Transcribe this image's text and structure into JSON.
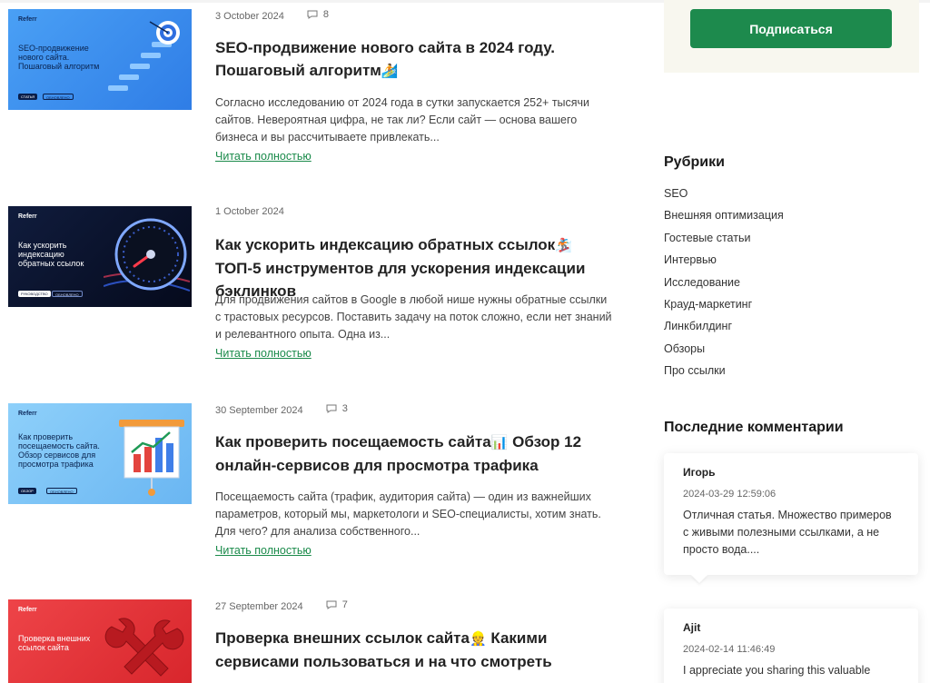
{
  "posts": [
    {
      "date": "3 October 2024",
      "comments": "8",
      "title": "SEO-продвижение нового сайта в 2024 году. Пошаговый алгоритм",
      "title_emoji": "🏄",
      "excerpt": "Согласно исследованию от 2024 года в сутки запускается 252+ тысячи сайтов. Невероятная цифра, не так ли? Если сайт — основа вашего бизнеса и вы рассчитываете привлекать...",
      "read_more": "Читать полностью",
      "thumb": {
        "brand": "Referr",
        "headline": "SEO-продвижение нового сайта. Пошаговый алгоритм",
        "pill1": "СТАТЬЯ",
        "pill2": "ОБНОВЛЕНО",
        "bg": "#3b8cf0",
        "icon": "target-stairs-icon"
      }
    },
    {
      "date": "1 October 2024",
      "comments": "",
      "title": "Как ускорить индексацию обратных ссылок",
      "title_emoji": "🏂",
      "title_rest": "ТОП-5 инструментов для ускорения индексации бэклинков",
      "excerpt": "Для продвижения сайтов в Google в любой нише нужны обратные ссылки с трастовых ресурсов. Поставить задачу на поток сложно, если нет знаний и релевантного опыта. Одна из...",
      "read_more": "Читать полностью",
      "thumb": {
        "brand": "Referr",
        "headline": "Как ускорить индексацию обратных ссылок",
        "pill1": "РУКОВОДСТВО",
        "pill2": "ОБНОВЛЕНО",
        "bg": "#0b1430",
        "icon": "speedometer-icon"
      }
    },
    {
      "date": "30 September 2024",
      "comments": "3",
      "title": "Как проверить посещаемость сайта",
      "title_emoji": "📊",
      "title_rest": "Обзор 12 онлайн-сервисов для просмотра трафика",
      "excerpt": "Посещаемость сайта (трафик, аудитория сайта) — один из важнейших параметров, который мы, маркетологи и SEO-специалисты, хотим знать. Для чего? для анализа собственного...",
      "read_more": "Читать полностью",
      "thumb": {
        "brand": "Referr",
        "headline": "Как проверить посещаемость сайта. Обзор сервисов для просмотра трафика",
        "pill1": "ОБЗОР",
        "pill2": "ОБНОВЛЕНО",
        "bg": "#7cc3f5",
        "icon": "chart-board-icon"
      }
    },
    {
      "date": "27 September 2024",
      "comments": "7",
      "title": "Проверка внешних ссылок сайта",
      "title_emoji": "👷",
      "title_rest": "Какими сервисами пользоваться и на что смотреть",
      "excerpt": "",
      "read_more": "",
      "thumb": {
        "brand": "Referr",
        "headline": "Проверка внешних ссылок сайта",
        "bg": "#e83a3f",
        "icon": "wrenches-icon"
      }
    }
  ],
  "sidebar": {
    "subscribe_label": "Подписаться",
    "rubrics_heading": "Рубрики",
    "rubrics": [
      "SEO",
      "Внешняя оптимизация",
      "Гостевые статьи",
      "Интервью",
      "Исследование",
      "Крауд-маркетинг",
      "Линкбилдинг",
      "Обзоры",
      "Про ссылки"
    ],
    "comments_heading": "Последние комментарии",
    "recent_comments": [
      {
        "author": "Игорь",
        "date": "2024-03-29 12:59:06",
        "text": "Отличная статья. Множество примеров с живыми полезными ссылками, а не просто вода...."
      },
      {
        "author": "Ajit",
        "date": "2024-02-14 11:46:49",
        "text": "I appreciate you sharing this valuable"
      }
    ]
  },
  "colors": {
    "accent_green": "#1d8a4d",
    "link_green": "#1a8a4a"
  }
}
